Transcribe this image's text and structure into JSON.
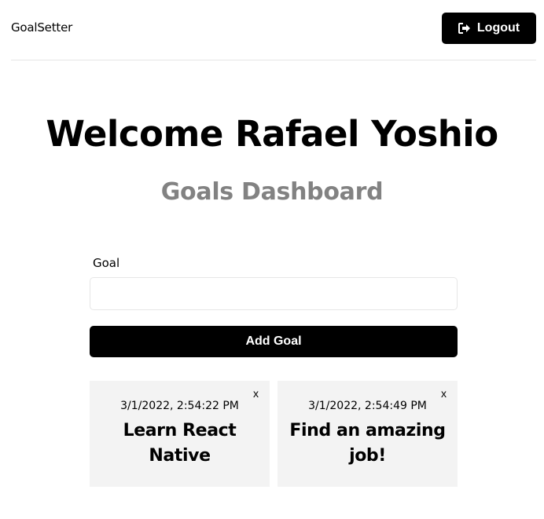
{
  "header": {
    "logo": "GoalSetter",
    "logout_label": "Logout",
    "logout_icon": "sign-out-icon"
  },
  "main": {
    "welcome": "Welcome Rafael Yoshio",
    "subtitle": "Goals Dashboard"
  },
  "form": {
    "goal_label": "Goal",
    "goal_value": "",
    "add_label": "Add Goal"
  },
  "goals": [
    {
      "date": "3/1/2022, 2:54:22 PM",
      "text": "Learn React Native",
      "delete_label": "x"
    },
    {
      "date": "3/1/2022, 2:54:49 PM",
      "text": "Find an amazing job!",
      "delete_label": "x"
    }
  ],
  "colors": {
    "primary": "#000000",
    "muted_heading": "#828282",
    "card_bg": "#f3f3f3",
    "border": "#e6e6e6"
  }
}
